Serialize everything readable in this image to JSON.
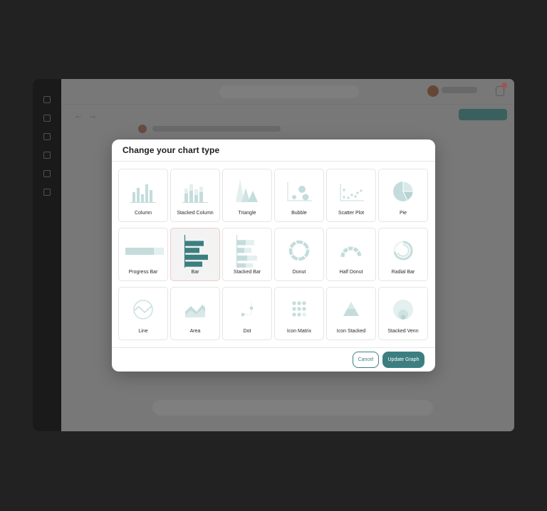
{
  "modal": {
    "title": "Change your chart type",
    "tiles": [
      {
        "label": "Column",
        "icon": "column-chart-icon"
      },
      {
        "label": "Stacked Column",
        "icon": "stacked-column-chart-icon"
      },
      {
        "label": "Triangle",
        "icon": "triangle-chart-icon"
      },
      {
        "label": "Bubble",
        "icon": "bubble-chart-icon"
      },
      {
        "label": "Scatter Plot",
        "icon": "scatter-plot-icon"
      },
      {
        "label": "Pie",
        "icon": "pie-chart-icon"
      },
      {
        "label": "Progress Bar",
        "icon": "progress-bar-icon"
      },
      {
        "label": "Bar",
        "icon": "bar-chart-icon",
        "selected": true
      },
      {
        "label": "Stacked Bar",
        "icon": "stacked-bar-chart-icon"
      },
      {
        "label": "Donut",
        "icon": "donut-chart-icon"
      },
      {
        "label": "Half Donut",
        "icon": "half-donut-chart-icon"
      },
      {
        "label": "Radial Bar",
        "icon": "radial-bar-chart-icon"
      },
      {
        "label": "Line",
        "icon": "line-chart-icon"
      },
      {
        "label": "Area",
        "icon": "area-chart-icon"
      },
      {
        "label": "Dot",
        "icon": "dot-chart-icon"
      },
      {
        "label": "Icon Matrix",
        "icon": "icon-matrix-chart-icon"
      },
      {
        "label": "Icon Stacked",
        "icon": "icon-stacked-chart-icon"
      },
      {
        "label": "Stacked Venn",
        "icon": "stacked-venn-chart-icon"
      }
    ],
    "cancel_label": "Cancel",
    "update_label": "Update Graph"
  },
  "colors": {
    "accent": "#3d7f80",
    "icon_light": "#c4dcdc",
    "icon_dark": "#3d7f80",
    "selected_border": "#f2c9c9"
  }
}
